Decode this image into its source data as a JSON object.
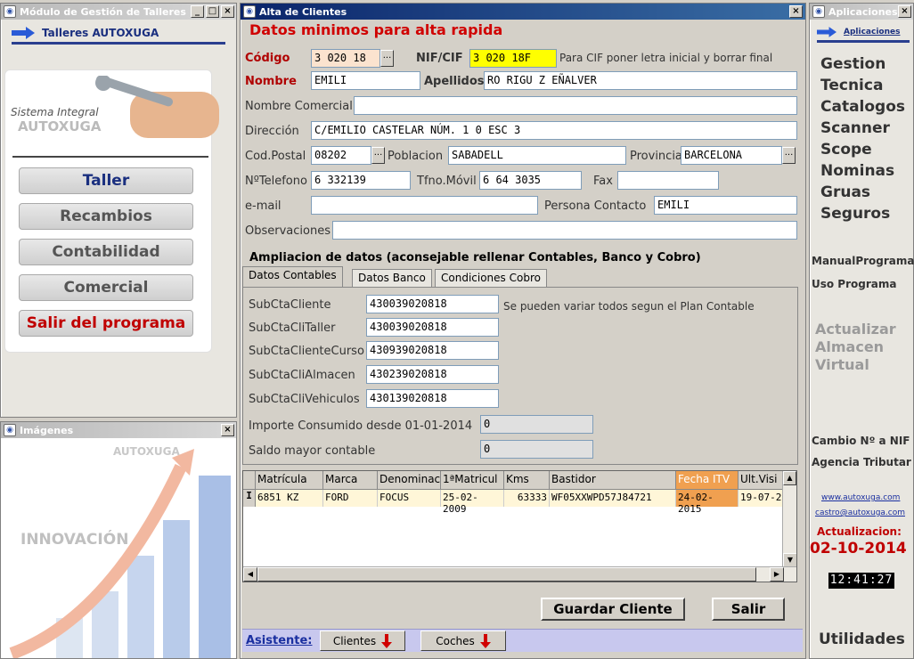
{
  "left_window": {
    "title": "Módulo de Gestión de Talleres",
    "header_link": "Talleres AUTOXUGA",
    "brand_line1": "Sistema Integral",
    "brand_line2": "AUTOXUGA",
    "menu": [
      "Taller",
      "Recambios",
      "Contabilidad",
      "Comercial",
      "Salir del programa"
    ]
  },
  "images_window": {
    "title": "Imágenes",
    "brand": "AUTOXUGA",
    "banner": "INNOVACIÓN"
  },
  "main_window": {
    "title": "Alta de Clientes",
    "heading": "Datos minimos para alta rapida",
    "labels": {
      "codigo": "Código",
      "nif": "NIF/CIF",
      "nif_hint": "Para CIF poner letra inicial y borrar final",
      "nombre": "Nombre",
      "apellidos": "Apellidos",
      "nombre_comercial": "Nombre Comercial",
      "direccion": "Dirección",
      "cod_postal": "Cod.Postal",
      "poblacion": "Poblacion",
      "provincia": "Provincia",
      "telefono": "NºTelefono",
      "movil": "Tfno.Móvil",
      "fax": "Fax",
      "email": "e-mail",
      "persona_contacto": "Persona Contacto",
      "observaciones": "Observaciones"
    },
    "values": {
      "codigo": "3 020 18",
      "nif": "3 020 18F",
      "nombre": "EMILI",
      "apellidos": "RO RIGU Z EÑALVER",
      "nombre_comercial": "",
      "direccion": "C/EMILIO CASTELAR NÚM. 1 0 ESC 3",
      "cod_postal": "08202",
      "poblacion": "SABADELL",
      "provincia": "BARCELONA",
      "telefono": "6 332139",
      "movil": "6 64 3035",
      "fax": "",
      "email": "",
      "persona_contacto": "EMILI",
      "observaciones": ""
    },
    "ampliacion": "Ampliacion de datos (aconsejable rellenar Contables, Banco y Cobro)",
    "tabs": [
      "Datos Contables",
      "Datos Banco",
      "Condiciones Cobro"
    ],
    "contables": {
      "rows": [
        {
          "label": "SubCtaCliente",
          "value": "430039020818"
        },
        {
          "label": "SubCtaCliTaller",
          "value": "430039020818"
        },
        {
          "label": "SubCtaClienteCurso",
          "value": "430939020818"
        },
        {
          "label": "SubCtaCliAlmacen",
          "value": "430239020818"
        },
        {
          "label": "SubCtaCliVehiculos",
          "value": "430139020818"
        }
      ],
      "hint": "Se pueden variar todos segun el Plan Contable",
      "importe_label": "Importe Consumido desde 01-01-2014",
      "importe_value": "0",
      "saldo_label": "Saldo mayor contable",
      "saldo_value": "0"
    },
    "grid": {
      "columns": [
        "Matrícula",
        "Marca",
        "Denominac",
        "1ªMatricul",
        "Kms",
        "Bastidor",
        "Fecha ITV",
        "Ult.Visi"
      ],
      "rows": [
        [
          "6851 KZ",
          "FORD",
          "FOCUS",
          "25-02-2009",
          "63333",
          "WF05XXWPD57J84721",
          "24-02-2015",
          "19-07-2"
        ]
      ],
      "row_marker": "I"
    },
    "buttons": {
      "guardar": "Guardar Cliente",
      "salir": "Salir"
    },
    "asistente": {
      "label": "Asistente:",
      "clientes": "Clientes",
      "coches": "Coches"
    }
  },
  "right_window": {
    "title": "Aplicaciones",
    "header_link": "Aplicaciones",
    "links": [
      "Gestion",
      "Tecnica",
      "Catalogos",
      "Scanner",
      "Scope",
      "Nominas",
      "Gruas",
      "Seguros"
    ],
    "manual": "ManualPrograma",
    "uso": "Uso Programa",
    "actualizar": [
      "Actualizar",
      "Almacen",
      "Virtual"
    ],
    "cambio": "Cambio Nº a NIF",
    "agencia": "Agencia Tributar",
    "web": "www.autoxuga.com",
    "email": "castro@autoxuga.com",
    "actualizacion_label": "Actualizacion:",
    "actualizacion_date": "02-10-2014",
    "clock": "12:41:27",
    "utilidades": "Utilidades"
  }
}
